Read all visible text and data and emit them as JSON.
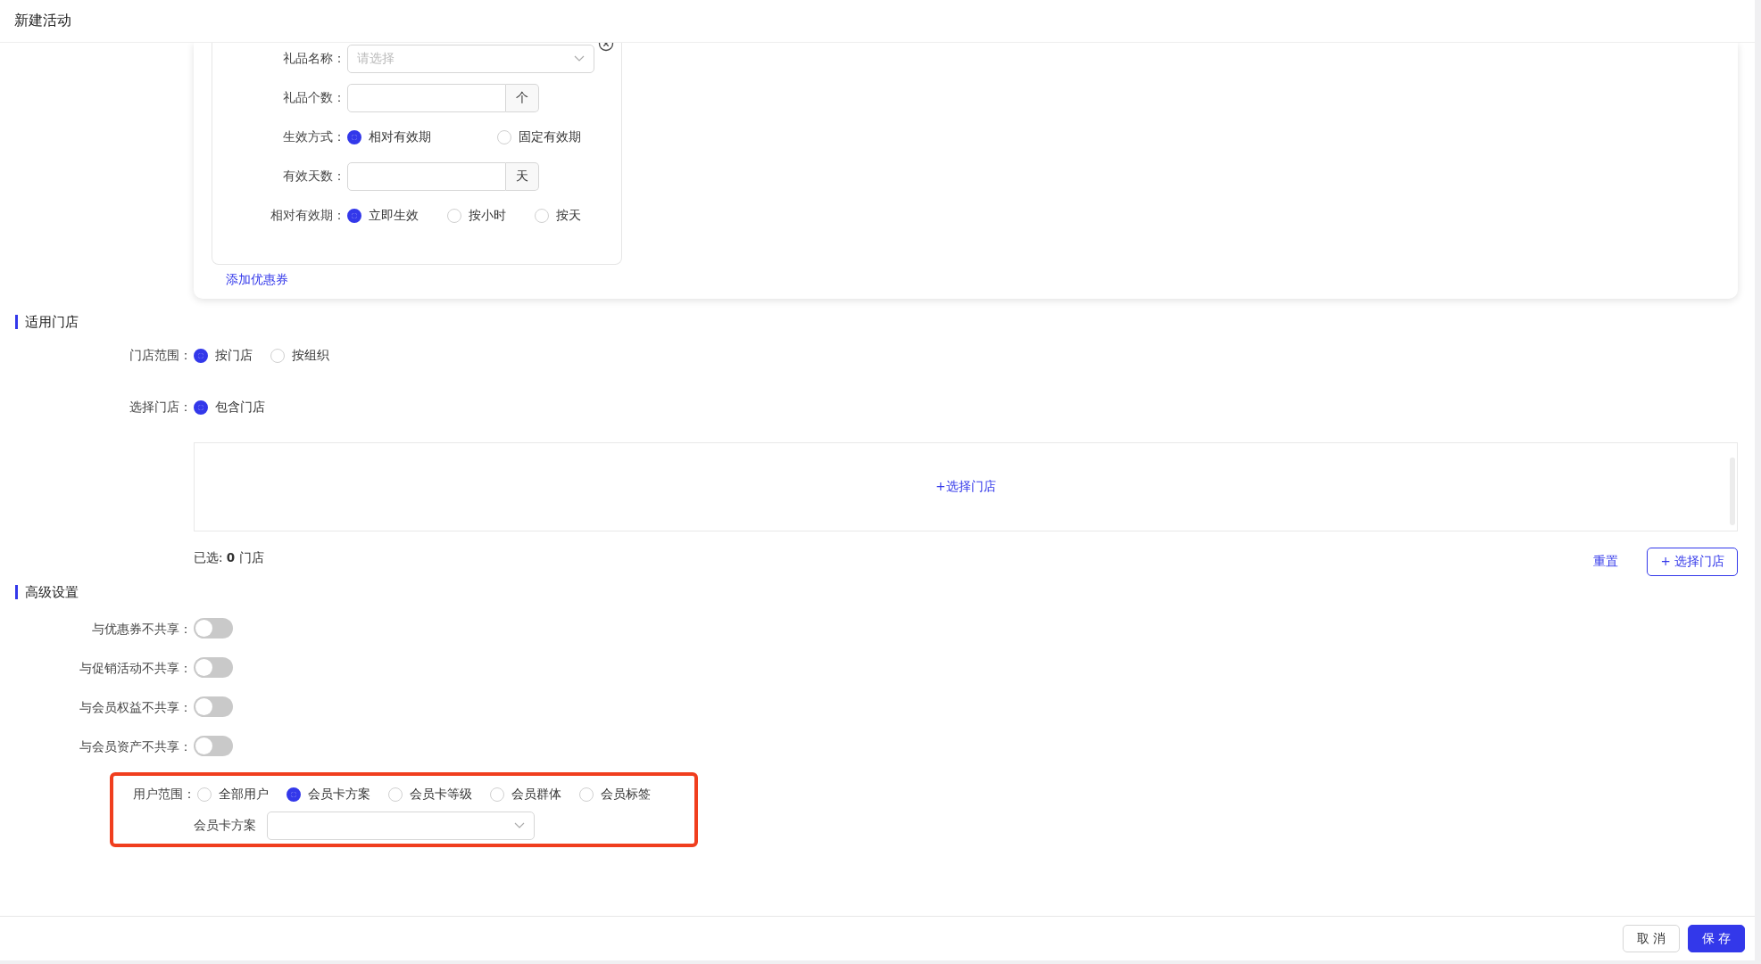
{
  "title": "新建活动",
  "coupon_form": {
    "fields": [
      {
        "kind": "select",
        "label": "礼品名称：",
        "placeholder": "请选择"
      },
      {
        "kind": "addon_input",
        "label": "礼品个数：",
        "addon": "个"
      },
      {
        "kind": "radio",
        "label": "生效方式：",
        "options": [
          {
            "label": "相对有效期",
            "selected": true
          },
          {
            "label": "固定有效期",
            "selected": false
          }
        ]
      },
      {
        "kind": "addon_input",
        "label": "有效天数：",
        "addon": "天"
      },
      {
        "kind": "radio",
        "label": "相对有效期：",
        "options": [
          {
            "label": "立即生效",
            "selected": true
          },
          {
            "label": "按小时",
            "selected": false
          },
          {
            "label": "按天",
            "selected": false
          }
        ]
      }
    ],
    "add_link": "添加优惠券"
  },
  "store_section": {
    "title": "适用门店",
    "scope": {
      "label": "门店范围：",
      "options": [
        {
          "label": "按门店",
          "selected": true
        },
        {
          "label": "按组织",
          "selected": false
        }
      ]
    },
    "select": {
      "label": "选择门店：",
      "options": [
        {
          "label": "包含门店",
          "selected": true
        }
      ]
    },
    "picker_link": "+选择门店",
    "summary": "已选: **0** 门店",
    "reset": "重置",
    "select_button": "+ 选择门店"
  },
  "advanced": {
    "title": "高级设置",
    "toggles": [
      {
        "label": "与优惠券不共享：",
        "on": false
      },
      {
        "label": "与促销活动不共享：",
        "on": false
      },
      {
        "label": "与会员权益不共享：",
        "on": false
      },
      {
        "label": "与会员资产不共享：",
        "on": false
      }
    ],
    "user_scope": {
      "highlighted": true,
      "label": "用户范围：",
      "options": [
        {
          "label": "全部用户",
          "selected": false
        },
        {
          "label": "会员卡方案",
          "selected": true
        },
        {
          "label": "会员卡等级",
          "selected": false
        },
        {
          "label": "会员群体",
          "selected": false
        },
        {
          "label": "会员标签",
          "selected": false
        }
      ],
      "plan_label": "会员卡方案"
    }
  },
  "footer": {
    "buttons": [
      {
        "label": "取 消",
        "kind": "default"
      },
      {
        "label": "保 存",
        "kind": "primary"
      }
    ]
  }
}
